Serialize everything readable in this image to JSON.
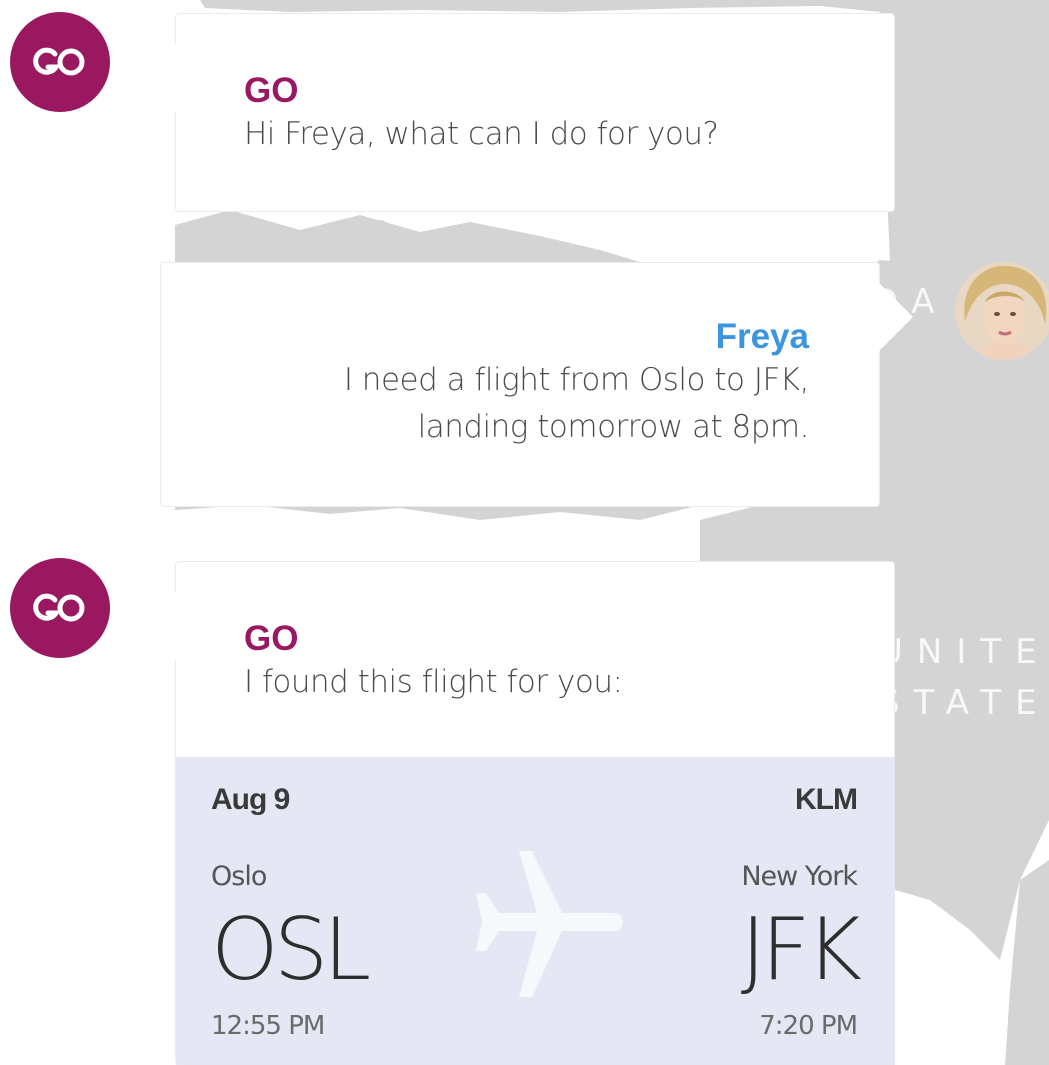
{
  "map": {
    "labels": [
      "CANADA",
      "UNITED",
      "STATES"
    ]
  },
  "messages": [
    {
      "sender": "GO",
      "avatar_text": "GO",
      "lines": [
        "Hi Freya, what can I do for you?"
      ]
    },
    {
      "sender": "Freya",
      "lines": [
        "I need a flight from Oslo to JFK,",
        "landing tomorrow at 8pm."
      ]
    },
    {
      "sender": "GO",
      "avatar_text": "GO",
      "lines": [
        "I found this flight for you:"
      ]
    }
  ],
  "flight": {
    "date": "Aug 9",
    "airline": "KLM",
    "origin_city": "Oslo",
    "origin_code": "OSL",
    "departure_time": "12:55 PM",
    "destination_city": "New York",
    "destination_code": "JFK",
    "arrival_time": "7:20 PM"
  },
  "colors": {
    "brand": "#9a1860",
    "user_name": "#3d95de",
    "card_bg": "#e5e8f4",
    "map_land": "#d4d4d4"
  },
  "icons": {
    "go_logo": "go-logo-icon",
    "plane": "airplane-icon"
  }
}
